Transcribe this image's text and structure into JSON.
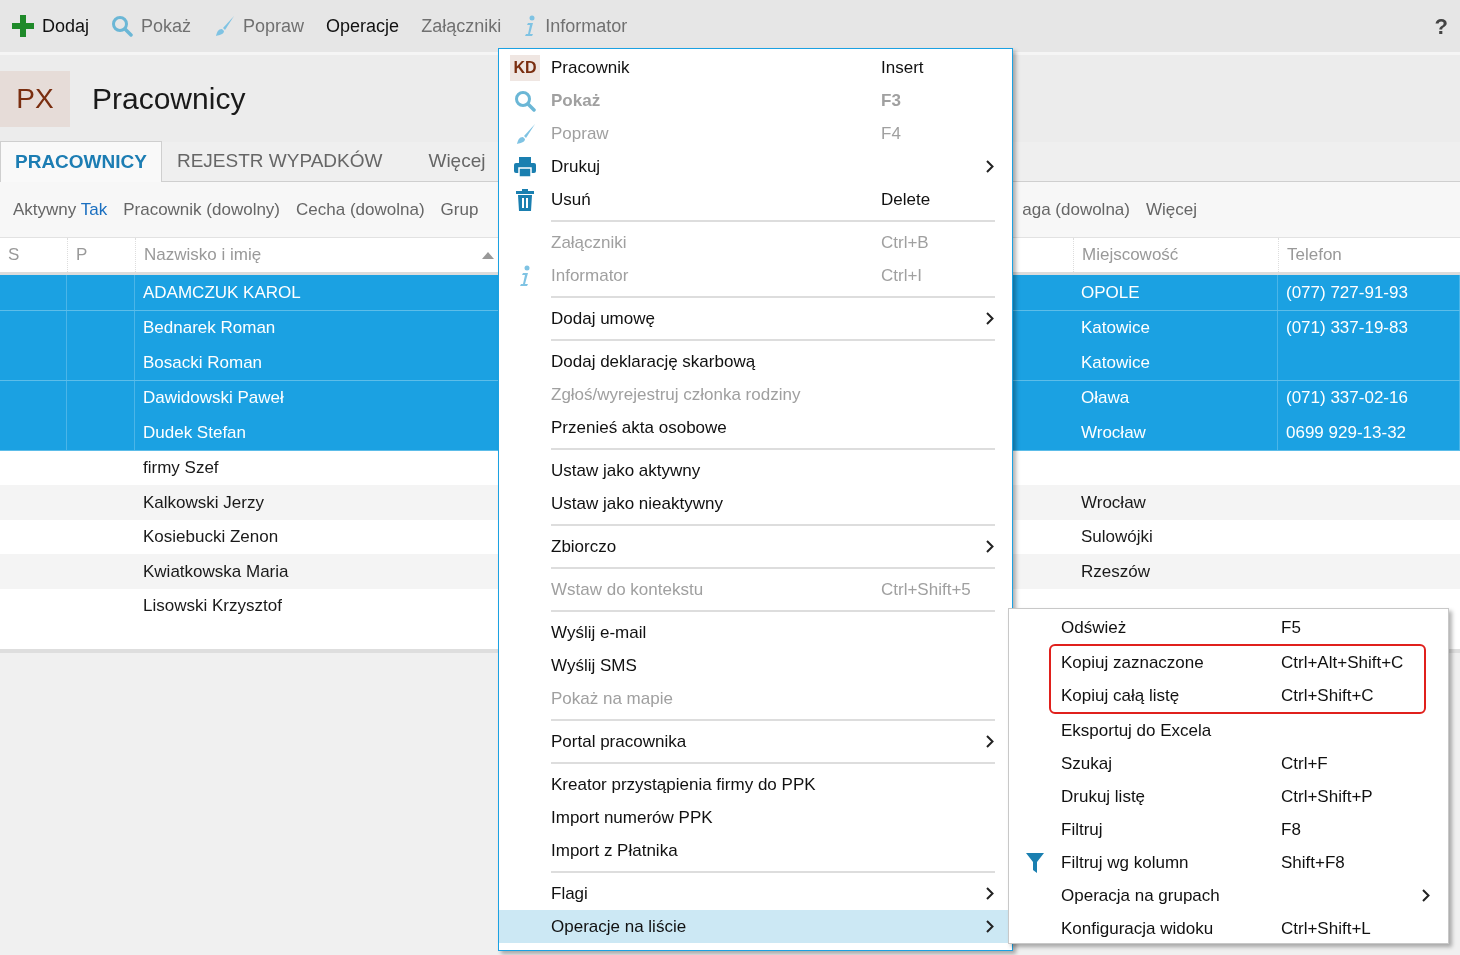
{
  "toolbar": {
    "items": [
      {
        "label": "Dodaj",
        "kind": "plus",
        "disabled": false
      },
      {
        "label": "Pokaż",
        "kind": "search",
        "disabled": true
      },
      {
        "label": "Popraw",
        "kind": "brush",
        "disabled": true
      },
      {
        "label": "Operacje",
        "kind": "plain",
        "disabled": false
      },
      {
        "label": "Załączniki",
        "kind": "plain",
        "disabled": true
      },
      {
        "label": "Informator",
        "kind": "info",
        "disabled": true
      }
    ],
    "help": "?"
  },
  "header": {
    "badge": "PX",
    "title": "Pracownicy"
  },
  "tabs": [
    {
      "label": "PRACOWNICY",
      "selected": true
    },
    {
      "label": "REJESTR WYPADKÓW",
      "selected": false
    },
    {
      "label": "Więcej",
      "selected": false
    }
  ],
  "filters": {
    "left": [
      {
        "label": "Aktywny",
        "value": "Tak"
      },
      {
        "label": "Pracownik (dowolny)"
      },
      {
        "label": "Cecha (dowolna)"
      },
      {
        "label": "Grup"
      }
    ],
    "right": [
      {
        "label": "aga (dowolna)"
      },
      {
        "label": "Więcej"
      }
    ]
  },
  "table": {
    "columns": [
      "S",
      "P",
      "Nazwisko i imię",
      "Miejscowość",
      "Telefon"
    ],
    "rows": [
      {
        "name": "ADAMCZUK KAROL",
        "city": "OPOLE",
        "phone": "(077) 727-91-93",
        "selected": true
      },
      {
        "name": "Bednarek Roman",
        "city": "Katowice",
        "phone": "(071) 337-19-83",
        "selected": true
      },
      {
        "name": "Bosacki Roman",
        "city": "Katowice",
        "selected": true
      },
      {
        "name": "Dawidowski Paweł",
        "city": "Oława",
        "phone": "(071) 337-02-16",
        "selected": true
      },
      {
        "name": "Dudek Stefan",
        "city": "Wrocław",
        "phone": "0699 929-13-32",
        "selected": true
      },
      {
        "name": "firmy Szef",
        "selected": false
      },
      {
        "name": "Kalkowski Jerzy",
        "city": "Wrocław",
        "selected": false
      },
      {
        "name": "Kosiebucki Zenon",
        "city": "Sulowójki",
        "selected": false
      },
      {
        "name": "Kwiatkowska Maria",
        "city": "Rzeszów",
        "selected": false
      },
      {
        "name": "Lisowski Krzysztof",
        "selected": false
      }
    ]
  },
  "menu": {
    "items": [
      {
        "kind": "badge",
        "label": "Pracownik",
        "shortcut": "Insert",
        "badge": "KD",
        "disabled": false,
        "selected": false
      },
      {
        "kind": "search",
        "label": "Pokaż",
        "shortcut": "F3",
        "bold": true,
        "disabled": true,
        "selected": false
      },
      {
        "kind": "brush",
        "label": "Popraw",
        "shortcut": "F4",
        "disabled": true,
        "selected": false
      },
      {
        "kind": "printer",
        "label": "Drukuj",
        "submenu": true,
        "disabled": false,
        "selected": false
      },
      {
        "kind": "trash",
        "label": "Usuń",
        "shortcut": "Delete",
        "disabled": false,
        "selected": false
      },
      {
        "kind": "separator"
      },
      {
        "kind": "plain",
        "label": "Załączniki",
        "shortcut": "Ctrl+B",
        "disabled": true,
        "selected": false
      },
      {
        "kind": "info",
        "label": "Informator",
        "shortcut": "Ctrl+I",
        "disabled": true,
        "selected": false
      },
      {
        "kind": "separator"
      },
      {
        "kind": "plain",
        "label": "Dodaj umowę",
        "submenu": true,
        "disabled": false,
        "selected": false
      },
      {
        "kind": "separator"
      },
      {
        "kind": "plain",
        "label": "Dodaj deklarację skarbową",
        "disabled": false,
        "selected": false
      },
      {
        "kind": "plain",
        "label": "Zgłoś/wyrejestruj członka rodziny",
        "disabled": true,
        "selected": false
      },
      {
        "kind": "plain",
        "label": "Przenieś akta osobowe",
        "disabled": false,
        "selected": false
      },
      {
        "kind": "separator"
      },
      {
        "kind": "plain",
        "label": "Ustaw jako aktywny",
        "disabled": false,
        "selected": false
      },
      {
        "kind": "plain",
        "label": "Ustaw jako nieaktywny",
        "disabled": false,
        "selected": false
      },
      {
        "kind": "separator"
      },
      {
        "kind": "plain",
        "label": "Zbiorczo",
        "submenu": true,
        "disabled": false,
        "selected": false
      },
      {
        "kind": "separator"
      },
      {
        "kind": "plain",
        "label": "Wstaw do kontekstu",
        "shortcut": "Ctrl+Shift+5",
        "disabled": true,
        "selected": false
      },
      {
        "kind": "separator"
      },
      {
        "kind": "plain",
        "label": "Wyślij e-mail",
        "disabled": false,
        "selected": false
      },
      {
        "kind": "plain",
        "label": "Wyślij SMS",
        "disabled": false,
        "selected": false
      },
      {
        "kind": "plain",
        "label": "Pokaż na mapie",
        "disabled": true,
        "selected": false
      },
      {
        "kind": "separator"
      },
      {
        "kind": "plain",
        "label": "Portal pracownika",
        "submenu": true,
        "disabled": false,
        "selected": false
      },
      {
        "kind": "separator"
      },
      {
        "kind": "plain",
        "label": "Kreator przystąpienia firmy do PPK",
        "disabled": false,
        "selected": false
      },
      {
        "kind": "plain",
        "label": "Import numerów PPK",
        "disabled": false,
        "selected": false
      },
      {
        "kind": "plain",
        "label": "Import z Płatnika",
        "disabled": false,
        "selected": false
      },
      {
        "kind": "separator"
      },
      {
        "kind": "plain",
        "label": "Flagi",
        "submenu": true,
        "disabled": false,
        "selected": false
      },
      {
        "kind": "plain",
        "label": "Operacje na liście",
        "submenu": true,
        "disabled": false,
        "selected": true
      }
    ]
  },
  "submenu": {
    "items": [
      {
        "kind": "plain",
        "label": "Odśwież",
        "shortcut": "F5",
        "marked": false
      },
      {
        "kind": "plain",
        "label": "Kopiuj zaznaczone",
        "shortcut": "Ctrl+Alt+Shift+C",
        "marked": true
      },
      {
        "kind": "plain",
        "label": "Kopiuj całą listę",
        "shortcut": "Ctrl+Shift+C",
        "marked": true
      },
      {
        "kind": "plain",
        "label": "Eksportuj do Excela",
        "marked": false
      },
      {
        "kind": "plain",
        "label": "Szukaj",
        "shortcut": "Ctrl+F",
        "marked": false
      },
      {
        "kind": "plain",
        "label": "Drukuj listę",
        "shortcut": "Ctrl+Shift+P",
        "marked": false
      },
      {
        "kind": "plain",
        "label": "Filtruj",
        "shortcut": "F8",
        "marked": false
      },
      {
        "kind": "funnel",
        "label": "Filtruj wg kolumn",
        "shortcut": "Shift+F8",
        "marked": false
      },
      {
        "kind": "plain",
        "label": "Operacja na grupach",
        "submenu": true,
        "marked": false
      },
      {
        "kind": "plain",
        "label": "Konfiguracja widoku",
        "shortcut": "Ctrl+Shift+L",
        "marked": false
      }
    ]
  }
}
